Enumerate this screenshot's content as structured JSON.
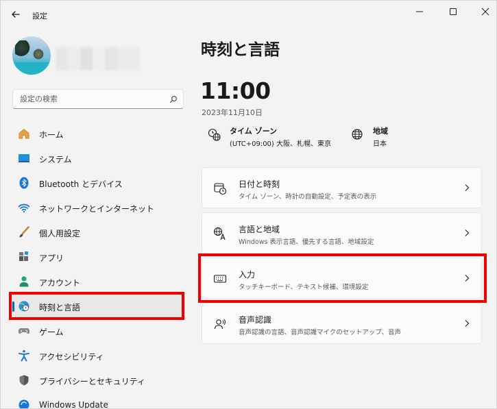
{
  "window": {
    "title": "設定"
  },
  "sidebar": {
    "search_placeholder": "設定の検索",
    "items": [
      {
        "label": "ホーム"
      },
      {
        "label": "システム"
      },
      {
        "label": "Bluetooth とデバイス"
      },
      {
        "label": "ネットワークとインターネット"
      },
      {
        "label": "個人用設定"
      },
      {
        "label": "アプリ"
      },
      {
        "label": "アカウント"
      },
      {
        "label": "時刻と言語",
        "selected": true
      },
      {
        "label": "ゲーム"
      },
      {
        "label": "アクセシビリティ"
      },
      {
        "label": "プライバシーとセキュリティ"
      },
      {
        "label": "Windows Update"
      }
    ]
  },
  "main": {
    "title": "時刻と言語",
    "time": "11:00",
    "date": "2023年11月10日",
    "timezone": {
      "label": "タイム ゾーン",
      "value": "(UTC+09:00) 大阪、札幌、東京"
    },
    "region": {
      "label": "地域",
      "value": "日本"
    },
    "cards": [
      {
        "title": "日付と時刻",
        "subtitle": "タイム ゾーン、時計の自動設定、予定表の表示",
        "icon": "calendar-clock-icon"
      },
      {
        "title": "言語と地域",
        "subtitle": "Windows 表示言語、優先する言語、地域設定",
        "icon": "language-icon"
      },
      {
        "title": "入力",
        "subtitle": "タッチキーボード、テキスト候補、環境設定",
        "icon": "keyboard-icon"
      },
      {
        "title": "音声認識",
        "subtitle": "音声認識の言語、音声認識マイクのセットアップ、音声",
        "icon": "speech-icon"
      }
    ]
  },
  "colors": {
    "accent": "#0067c0",
    "highlight": "#ef0000",
    "background": "#f3f3f3"
  }
}
